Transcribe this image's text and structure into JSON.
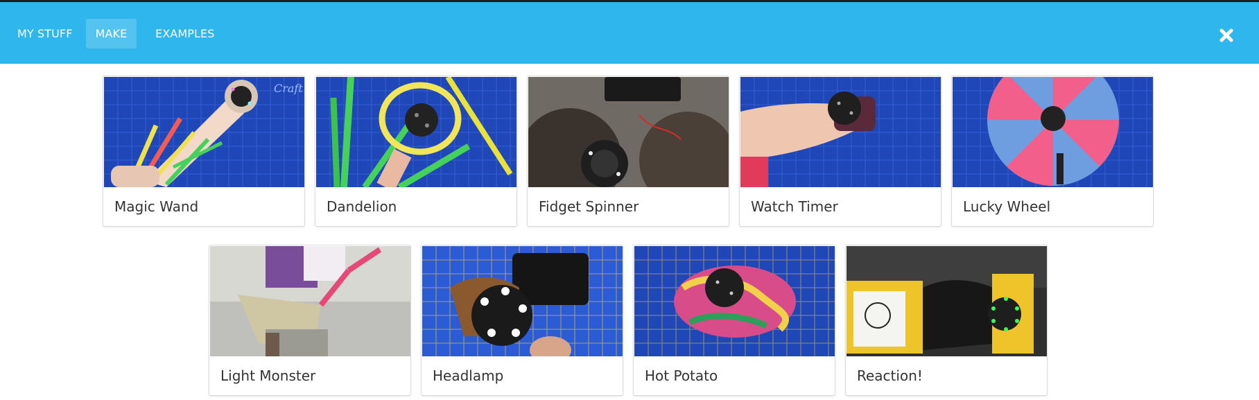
{
  "header": {
    "tabs": [
      {
        "label": "MY STUFF",
        "active": false
      },
      {
        "label": "MAKE",
        "active": true
      },
      {
        "label": "EXAMPLES",
        "active": false
      }
    ],
    "close_icon": "close-icon",
    "background": "#2fb6ec"
  },
  "gallery": {
    "row1": [
      {
        "title": "Magic Wand"
      },
      {
        "title": "Dandelion"
      },
      {
        "title": "Fidget Spinner"
      },
      {
        "title": "Watch Timer"
      },
      {
        "title": "Lucky Wheel"
      }
    ],
    "row2": [
      {
        "title": "Light Monster"
      },
      {
        "title": "Headlamp"
      },
      {
        "title": "Hot Potato"
      },
      {
        "title": "Reaction!"
      }
    ]
  }
}
